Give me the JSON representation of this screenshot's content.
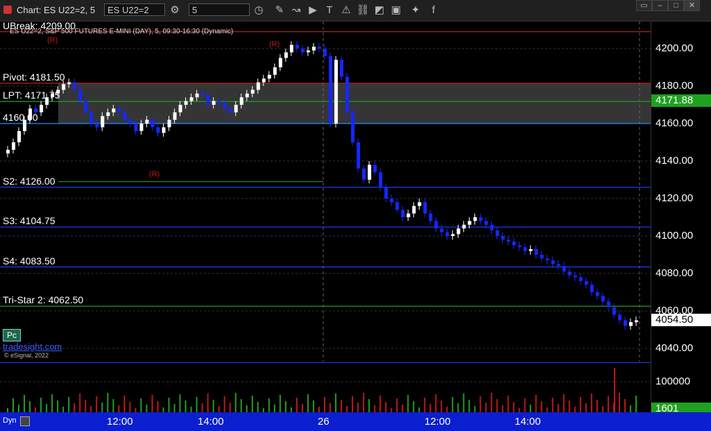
{
  "window": {
    "title": "Chart: ES U22=2, 5"
  },
  "toolbar": {
    "symbol_value": "ES U22=2",
    "interval_value": "5"
  },
  "chart": {
    "subtitle": "ES U22=2, S&P 500 FUTURES E-MINI (DAY), 5, 09:30-16:30 (Dynamic)",
    "r_marker": "(R)",
    "link_text": "tradesight.com",
    "copyright": "© eSignal, 2022",
    "pc_label": "Pc",
    "dyn_label": "Dyn"
  },
  "levels": [
    {
      "label": "UBreak: 4209.00",
      "price": 4209.0,
      "color": "#d02020"
    },
    {
      "label": "Pivot: 4181.50",
      "price": 4181.5,
      "color": "#d02020"
    },
    {
      "label": "LPT: 4171.75",
      "price": 4171.75,
      "color": "#20a020"
    },
    {
      "label": "4160.00",
      "price": 4160.0,
      "color": "#2090ff"
    },
    {
      "label": "S2: 4126.00",
      "price": 4126.0,
      "color": "#2040ff"
    },
    {
      "label": "S3: 4104.75",
      "price": 4104.75,
      "color": "#2040ff"
    },
    {
      "label": "S4: 4083.50",
      "price": 4083.5,
      "color": "#2040ff"
    },
    {
      "label": "Tri-Star 2: 4062.50",
      "price": 4062.5,
      "color": "#20a020"
    }
  ],
  "price_axis": {
    "ticks": [
      "4200.00",
      "4180.00",
      "4160.00",
      "4140.00",
      "4120.00",
      "4100.00",
      "4080.00",
      "4060.00",
      "4040.00"
    ],
    "tick_values": [
      4200,
      4180,
      4160,
      4140,
      4120,
      4100,
      4080,
      4060,
      4040
    ],
    "lpt_badge": "4171.88",
    "last_price": "4054.50",
    "volume_tick": "100000",
    "volume_last": "1601"
  },
  "time_axis": {
    "labels": [
      "12:00",
      "14:00",
      "26",
      "12:00",
      "14:00"
    ]
  },
  "colors": {
    "up": "#ffffff",
    "down": "#1428ff",
    "setup": "#1fa01f",
    "countdown": "#e020e0"
  },
  "chart_data": {
    "type": "candlestick",
    "y_range": [
      4030,
      4212
    ],
    "closes": [
      4146,
      4150,
      4156,
      4162,
      4168,
      4166,
      4170,
      4174,
      4176,
      4178,
      4181,
      4182,
      4178,
      4172,
      4166,
      4160,
      4158,
      4164,
      4166,
      4168,
      4166,
      4162,
      4160,
      4156,
      4160,
      4162,
      4158,
      4155,
      4158,
      4162,
      4166,
      4170,
      4172,
      4174,
      4176,
      4175,
      4170,
      4172,
      4171,
      4168,
      4166,
      4170,
      4174,
      4176,
      4178,
      4182,
      4184,
      4186,
      4190,
      4195,
      4198,
      4202,
      4200,
      4198,
      4199,
      4201,
      4200,
      4196,
      4160,
      4194,
      4185,
      4166,
      4150,
      4136,
      4130,
      4138,
      4134,
      4126,
      4120,
      4118,
      4114,
      4110,
      4112,
      4116,
      4118,
      4112,
      4108,
      4104,
      4102,
      4100,
      4101,
      4104,
      4106,
      4108,
      4110,
      4108,
      4106,
      4103,
      4100,
      4098,
      4097,
      4095,
      4094,
      4092,
      4093,
      4090,
      4088,
      4087,
      4085,
      4084,
      4081,
      4079,
      4078,
      4076,
      4074,
      4070,
      4068,
      4065,
      4062,
      4058,
      4055,
      4052,
      4054,
      4055
    ]
  }
}
